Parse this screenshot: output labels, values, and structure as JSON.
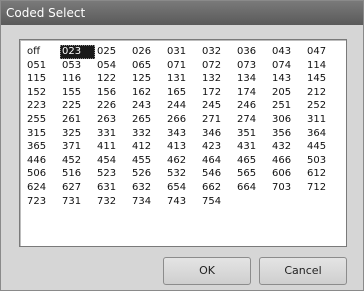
{
  "window": {
    "title": "Coded Select"
  },
  "codes": [
    "off",
    "023",
    "025",
    "026",
    "031",
    "032",
    "036",
    "043",
    "047",
    "051",
    "053",
    "054",
    "065",
    "071",
    "072",
    "073",
    "074",
    "114",
    "115",
    "116",
    "122",
    "125",
    "131",
    "132",
    "134",
    "143",
    "145",
    "152",
    "155",
    "156",
    "162",
    "165",
    "172",
    "174",
    "205",
    "212",
    "223",
    "225",
    "226",
    "243",
    "244",
    "245",
    "246",
    "251",
    "252",
    "255",
    "261",
    "263",
    "265",
    "266",
    "271",
    "274",
    "306",
    "311",
    "315",
    "325",
    "331",
    "332",
    "343",
    "346",
    "351",
    "356",
    "364",
    "365",
    "371",
    "411",
    "412",
    "413",
    "423",
    "431",
    "432",
    "445",
    "446",
    "452",
    "454",
    "455",
    "462",
    "464",
    "465",
    "466",
    "503",
    "506",
    "516",
    "523",
    "526",
    "532",
    "546",
    "565",
    "606",
    "612",
    "624",
    "627",
    "631",
    "632",
    "654",
    "662",
    "664",
    "703",
    "712",
    "723",
    "731",
    "732",
    "734",
    "743",
    "754"
  ],
  "selected_code": "023",
  "buttons": {
    "ok": "OK",
    "cancel": "Cancel"
  }
}
